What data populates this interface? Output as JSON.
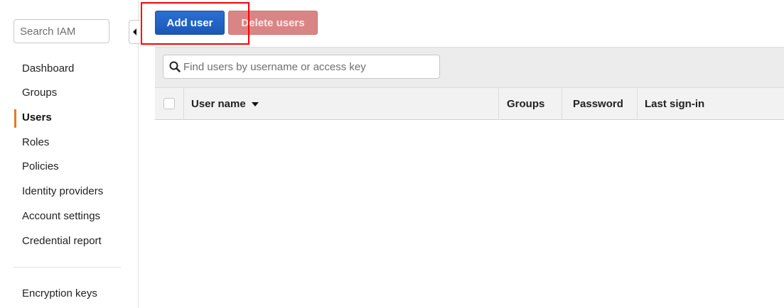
{
  "sidebar": {
    "search": {
      "placeholder": "Search IAM"
    },
    "items": [
      {
        "label": "Dashboard",
        "active": false
      },
      {
        "label": "Groups",
        "active": false
      },
      {
        "label": "Users",
        "active": true
      },
      {
        "label": "Roles",
        "active": false
      },
      {
        "label": "Policies",
        "active": false
      },
      {
        "label": "Identity providers",
        "active": false
      },
      {
        "label": "Account settings",
        "active": false
      },
      {
        "label": "Credential report",
        "active": false
      }
    ],
    "footer_items": [
      {
        "label": "Encryption keys"
      }
    ]
  },
  "toolbar": {
    "add_user_label": "Add user",
    "delete_users_label": "Delete users"
  },
  "filter": {
    "placeholder": "Find users by username or access key"
  },
  "table": {
    "columns": [
      {
        "label": "User name",
        "sorted": "descending"
      },
      {
        "label": "Groups"
      },
      {
        "label": "Password"
      },
      {
        "label": "Last sign-in"
      }
    ],
    "rows": []
  },
  "colors": {
    "primary": "#1b58b6",
    "danger": "#d98585",
    "active_nav_accent": "#e07b24",
    "highlight_box": "#ff0000"
  }
}
